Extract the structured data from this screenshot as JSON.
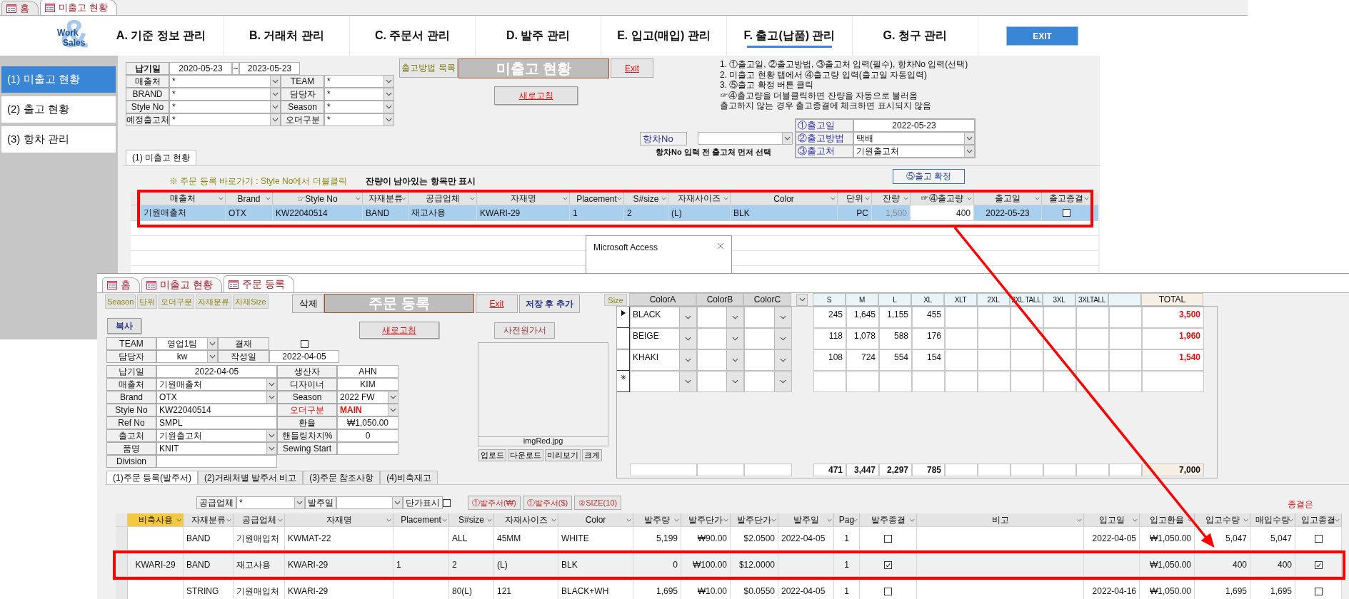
{
  "main_window": {
    "doc_tabs": [
      {
        "label": "홈",
        "selected": false
      },
      {
        "label": "미출고 현황",
        "selected": true
      }
    ],
    "logo": {
      "symbol": "&",
      "line1": "Work",
      "line2": "Sales"
    },
    "nav": [
      {
        "label": "A. 기준 정보 관리",
        "selected": false
      },
      {
        "label": "B. 거래처 관리",
        "selected": false
      },
      {
        "label": "C. 주문서 관리",
        "selected": false
      },
      {
        "label": "D. 발주 관리",
        "selected": false
      },
      {
        "label": "E. 입고(매입) 관리",
        "selected": false
      },
      {
        "label": "F. 출고(납품) 관리",
        "selected": true
      },
      {
        "label": "G. 청구 관리",
        "selected": false
      }
    ],
    "exit_button": "EXIT",
    "sidebar": [
      {
        "label": "(1) 미출고 현황",
        "selected": true
      },
      {
        "label": "(2) 출고 현황",
        "selected": false
      },
      {
        "label": "(3) 항차 관리",
        "selected": false
      }
    ],
    "filters": {
      "date_label": "납기일",
      "date_from": "2020-05-23",
      "date_separator": "~",
      "date_to": "2023-05-23",
      "fields": [
        {
          "label": "매출처",
          "value": "*"
        },
        {
          "label": "TEAM",
          "value": "*"
        },
        {
          "label": "BRAND",
          "value": "*"
        },
        {
          "label": "담당자",
          "value": "*"
        },
        {
          "label": "Style No",
          "value": "*"
        },
        {
          "label": "Season",
          "value": "*"
        },
        {
          "label": "예정출고처",
          "value": "*"
        },
        {
          "label": "오더구분",
          "value": "*"
        }
      ]
    },
    "method_list_label": "출고방법 목록",
    "title": "미출고 현황",
    "exit_link": "Exit",
    "refresh_button": "새로고침",
    "instructions": [
      "1. ①출고일, ②출고방법, ③출고처 입력(필수), 항차No 입력(선택)",
      "2. 미출고 현황 탭에서 ④출고량 입력(출고일 자동입력)",
      "3. ⑤출고 확정 버튼 클릭",
      "☞④출고량을 더블클릭하면 잔량을 자동으로 불러옴",
      "출고하지 않는 경우 출고종결에 체크하면 표시되지 않음"
    ],
    "voyage": {
      "label": "항차No",
      "note": "항차No 입력 전 출고처 먼저 선택"
    },
    "shipping": [
      {
        "label": "①출고일",
        "value": "2022-05-23",
        "kind": "text"
      },
      {
        "label": "②출고방법",
        "value": "택배",
        "kind": "combo"
      },
      {
        "label": "③출고처",
        "value": "기원출고처",
        "kind": "combo"
      }
    ],
    "sub_tabs": [
      {
        "label": "(1) 미출고 현황",
        "selected": true
      }
    ],
    "shortcut_note": "※ 주문 등록 바로가기 : Style No에서 더블클릭",
    "filter_note": "잔량이 남아있는 항목만 표시",
    "confirm_button": "⑤출고 확정",
    "table": {
      "columns": [
        {
          "label": "매출처",
          "kind": "text"
        },
        {
          "label": "Brand",
          "kind": "text"
        },
        {
          "label": "☞Style No",
          "kind": "text"
        },
        {
          "label": "자재분류",
          "kind": "text"
        },
        {
          "label": "공급업체",
          "kind": "text"
        },
        {
          "label": "자재명",
          "kind": "text"
        },
        {
          "label": "Placement",
          "kind": "text"
        },
        {
          "label": "S#size",
          "kind": "text"
        },
        {
          "label": "자재사이즈",
          "kind": "text"
        },
        {
          "label": "Color",
          "kind": "text"
        },
        {
          "label": "단위",
          "kind": "text"
        },
        {
          "label": "잔량",
          "kind": "text"
        },
        {
          "label": "☞④출고량",
          "kind": "text"
        },
        {
          "label": "출고일",
          "kind": "text"
        },
        {
          "label": "출고종결",
          "kind": "check"
        }
      ],
      "rows": [
        {
          "selected": true,
          "cells": [
            "기원매출처",
            "OTX",
            "KW22040514",
            "BAND",
            "재고사용",
            "KWARI-29",
            "1",
            "2",
            "(L)",
            "BLK",
            "PC",
            "1,500",
            "400",
            "2022-05-23",
            false
          ]
        }
      ]
    },
    "dialog": {
      "title": "Microsoft Access"
    }
  },
  "order_window": {
    "doc_tabs": [
      {
        "label": "홈",
        "selected": false
      },
      {
        "label": "미출고 현황",
        "selected": false
      },
      {
        "label": "주문 등록",
        "selected": true
      }
    ],
    "toolbar": [
      "Season",
      "단위",
      "오더구분",
      "자재분류",
      "자재Size"
    ],
    "delete_button": "삭제",
    "title": "주문 등록",
    "exit_link": "Exit",
    "save_add_button": "저장 후 추가",
    "size_button": "Size",
    "copy_button": "복사",
    "refresh_button": "새로고침",
    "cost_sheet_button": "사전원가서",
    "image": {
      "caption": "imgRed.jpg"
    },
    "image_buttons": [
      "업로드",
      "다운로드",
      "미리보기",
      "크게"
    ],
    "team": {
      "team_label": "TEAM",
      "team": "영업1팀",
      "approval_label": "결재",
      "approved": false,
      "manager_label": "담당자",
      "manager": "kw",
      "created_label": "작성일",
      "created": "2022-04-05"
    },
    "fields": [
      {
        "label": "납기일",
        "value": "2022-04-05",
        "kind": "date",
        "alert": false
      },
      {
        "label": "생산자",
        "value": "AHN",
        "kind": "text",
        "alert": false
      },
      {
        "label": "매출처",
        "value": "기원매출처",
        "kind": "combo",
        "alert": false
      },
      {
        "label": "디자이너",
        "value": "KIM",
        "kind": "text",
        "alert": false
      },
      {
        "label": "Brand",
        "value": "OTX",
        "kind": "combo",
        "alert": false
      },
      {
        "label": "Season",
        "value": "2022 FW",
        "kind": "combo",
        "alert": false
      },
      {
        "label": "Style No",
        "value": "KW22040514",
        "kind": "text",
        "alert": false
      },
      {
        "label": "오더구분",
        "value": "MAIN",
        "kind": "combo",
        "alert": true
      },
      {
        "label": "Ref No",
        "value": "SMPL",
        "kind": "text",
        "alert": false
      },
      {
        "label": "환율",
        "value": "₩1,050.00",
        "kind": "text",
        "alert": false
      },
      {
        "label": "출고처",
        "value": "기원출고처",
        "kind": "combo",
        "alert": false
      },
      {
        "label": "핸들링차지%",
        "value": "0",
        "kind": "text",
        "alert": false
      },
      {
        "label": "품명",
        "value": "KNIT",
        "kind": "combo",
        "alert": false
      },
      {
        "label": "Sewing Start",
        "kind": "text",
        "alert": false
      },
      {
        "label": "Division",
        "kind": "text",
        "alert": false
      }
    ],
    "sub_tabs": [
      {
        "label": "(1)주문 등록(발주서)",
        "selected": true
      },
      {
        "label": "(2)거래처별 발주서 비고",
        "selected": false
      },
      {
        "label": "(3)주문 참조사항",
        "selected": false
      },
      {
        "label": "(4)비축재고",
        "selected": false
      }
    ],
    "size_grid": {
      "color_columns": [
        "ColorA",
        "ColorB",
        "ColorC"
      ],
      "size_columns": [
        "S",
        "M",
        "L",
        "XL",
        "XLT",
        "2XL",
        "2XL TALL",
        "3XL",
        "3XLTALL"
      ],
      "total_label": "TOTAL",
      "rows": [
        {
          "kind": "current",
          "color_a": "BLACK",
          "sizes": [
            "245",
            "1,645",
            "1,155",
            "455"
          ],
          "total": "3,500"
        },
        {
          "kind": "normal",
          "color_a": "BEIGE",
          "sizes": [
            "118",
            "1,078",
            "588",
            "176"
          ],
          "total": "1,960"
        },
        {
          "kind": "normal",
          "color_a": "KHAKI",
          "sizes": [
            "108",
            "724",
            "554",
            "154"
          ],
          "total": "1,540"
        },
        {
          "kind": "new"
        }
      ],
      "totals": {
        "sizes": [
          "471",
          "3,447",
          "2,297",
          "785"
        ],
        "total": "7,000"
      }
    },
    "filter_bar": {
      "supplier_label": "공급업체",
      "supplier": "*",
      "date_label": "발주일",
      "price_label": "단가표시",
      "show_price": false,
      "buttons": [
        "①발주서(₩)",
        "①발주서($)",
        "②SIZE(10)"
      ],
      "note": "종결은"
    },
    "table": {
      "columns": [
        {
          "label": "비축사용",
          "kind": "text"
        },
        {
          "label": "자재분류",
          "kind": "text"
        },
        {
          "label": "공급업체",
          "kind": "text"
        },
        {
          "label": "자재명",
          "kind": "text"
        },
        {
          "label": "Placement",
          "kind": "text"
        },
        {
          "label": "S#size",
          "kind": "text"
        },
        {
          "label": "자재사이즈",
          "kind": "text"
        },
        {
          "label": "Color",
          "kind": "text"
        },
        {
          "label": "발주량",
          "kind": "text"
        },
        {
          "label": "발주단가",
          "kind": "text"
        },
        {
          "label": "발주단가",
          "kind": "text"
        },
        {
          "label": "발주일",
          "kind": "text"
        },
        {
          "label": "Pag",
          "kind": "text"
        },
        {
          "label": "발주종결",
          "kind": "check"
        },
        {
          "label": "비고",
          "kind": "text"
        },
        {
          "label": "입고일",
          "kind": "text"
        },
        {
          "label": "입고환율",
          "kind": "text"
        },
        {
          "label": "입고수량",
          "kind": "text"
        },
        {
          "label": "매입수량",
          "kind": "text"
        },
        {
          "label": "입고종결",
          "kind": "check"
        }
      ],
      "rows": [
        {
          "selected": false,
          "highlighted": false,
          "cells": [
            null,
            "BAND",
            "기원매입처",
            "KWMAT-22",
            null,
            "ALL",
            "45MM",
            "WHITE",
            "5,199",
            "₩90.00",
            "$2.0500",
            "2022-04-05",
            "1",
            false,
            null,
            "2022-04-05",
            "₩1,050.00",
            "5,047",
            "5,047",
            false
          ]
        },
        {
          "selected": false,
          "highlighted": true,
          "cells": [
            "KWARI-29",
            "BAND",
            "재고사용",
            "KWARI-29",
            "1",
            "2",
            "(L)",
            "BLK",
            "0",
            "₩100.00",
            "$12.0000",
            null,
            "1",
            true,
            null,
            null,
            "₩1,050.00",
            "400",
            "400",
            true
          ]
        },
        {
          "selected": false,
          "highlighted": false,
          "cells": [
            null,
            "STRING",
            "기원매입처",
            "KWARI-29",
            null,
            "80(L)",
            "121",
            "BLACK+WH",
            "1,695",
            "₩10.00",
            "$0.0550",
            "2022-04-05",
            "1",
            false,
            null,
            "2022-04-16",
            "₩1,050.00",
            "1,695",
            "1,695",
            false
          ]
        }
      ]
    }
  }
}
